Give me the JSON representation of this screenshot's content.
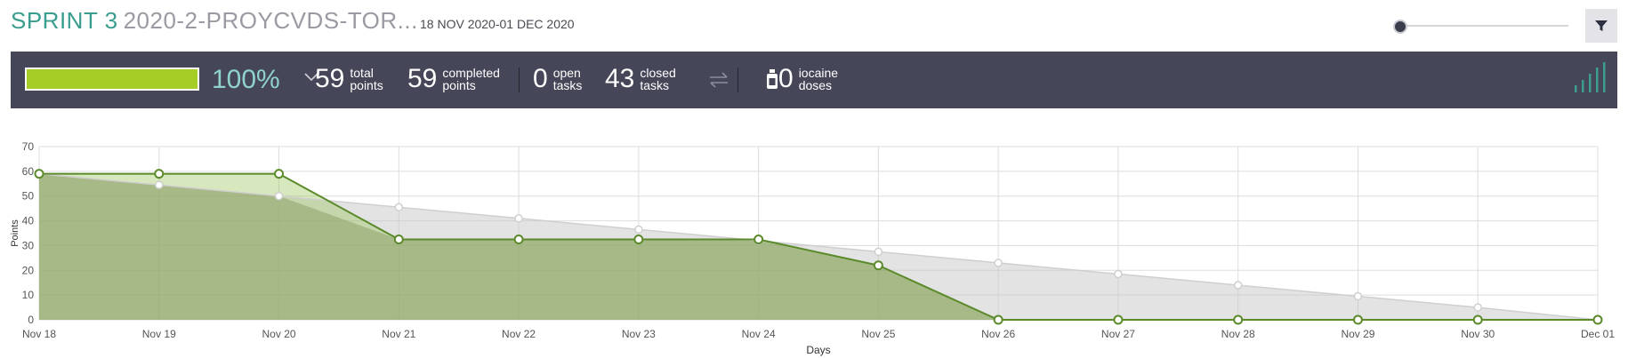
{
  "header": {
    "sprint_label": "SPRINT 3",
    "project_label": "2020-2-PROYCVDS-TOR...",
    "dates": "18 NOV 2020-01 DEC 2020",
    "filter_icon": "filter-icon"
  },
  "summary": {
    "progress": 1.0,
    "percent": "100%",
    "total_points": "59",
    "total_points_label_1": "total",
    "total_points_label_2": "points",
    "completed_points": "59",
    "completed_points_label_1": "completed",
    "completed_points_label_2": "points",
    "open_tasks": "0",
    "open_tasks_label_1": "open",
    "open_tasks_label_2": "tasks",
    "closed_tasks": "43",
    "closed_tasks_label_1": "closed",
    "closed_tasks_label_2": "tasks",
    "iocaine": "0",
    "iocaine_label_1": "iocaine",
    "iocaine_label_2": "doses",
    "colors": {
      "bar": "#454657",
      "progress": "#a6cc26",
      "percent": "#8fd3cb"
    }
  },
  "chart_data": {
    "type": "area",
    "xlabel": "Days",
    "ylabel": "Points",
    "ylim": [
      0,
      70
    ],
    "yticks": [
      0,
      10,
      20,
      30,
      40,
      50,
      60,
      70
    ],
    "categories": [
      "Nov 18",
      "Nov 19",
      "Nov 20",
      "Nov 21",
      "Nov 22",
      "Nov 23",
      "Nov 24",
      "Nov 25",
      "Nov 26",
      "Nov 27",
      "Nov 28",
      "Nov 29",
      "Nov 30",
      "Dec 01"
    ],
    "grid": true,
    "series": [
      {
        "values": [
          59,
          54.5,
          50,
          45.5,
          41,
          36.5,
          32,
          27.5,
          23,
          18.5,
          14,
          9.5,
          5,
          0
        ],
        "color": "#c8c8c8"
      },
      {
        "values": [
          59,
          59,
          59,
          32.5,
          32.5,
          32.5,
          32.5,
          22,
          0,
          0,
          0,
          0,
          0,
          0
        ],
        "color": "#5a8a2a"
      }
    ]
  }
}
